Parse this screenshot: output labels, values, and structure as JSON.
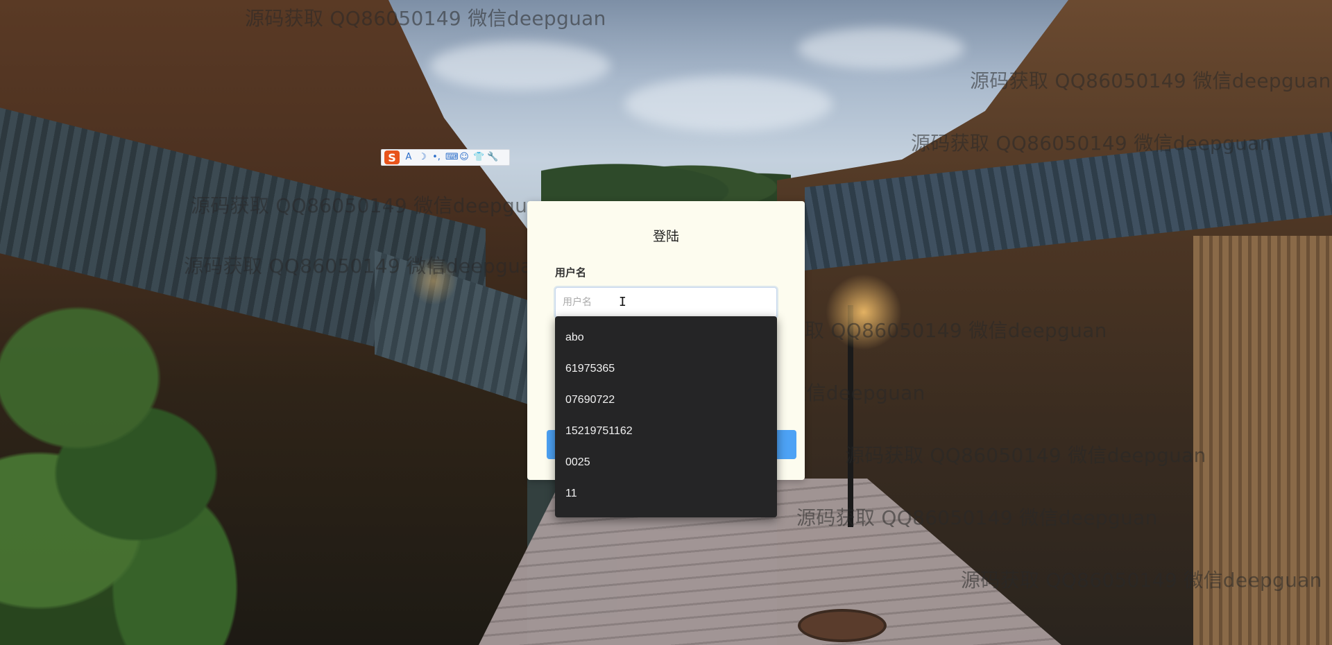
{
  "ime_toolbar": {
    "logo": "S",
    "icons": [
      "letter-a-icon",
      "moon-icon",
      "punctuation-icon",
      "keyboard-icon",
      "user-icon",
      "shirt-icon",
      "wrench-icon"
    ],
    "glyphs": [
      "A",
      "☽",
      "•,",
      "⌨",
      "☺",
      "👕",
      "🔧"
    ]
  },
  "login": {
    "title": "登陆",
    "username_label": "用户名",
    "username_placeholder": "用户名",
    "username_value": "",
    "login_button_label": ""
  },
  "autocomplete": {
    "items": [
      "abo",
      "61975365",
      "07690722",
      "15219751162",
      "0025",
      "11"
    ]
  },
  "watermark": {
    "text": "源码获取 QQ86050149 微信deepguan"
  },
  "colors": {
    "card_bg": "#fdfcef",
    "dropdown_bg": "#252526",
    "primary_button": "#4da2f5"
  }
}
